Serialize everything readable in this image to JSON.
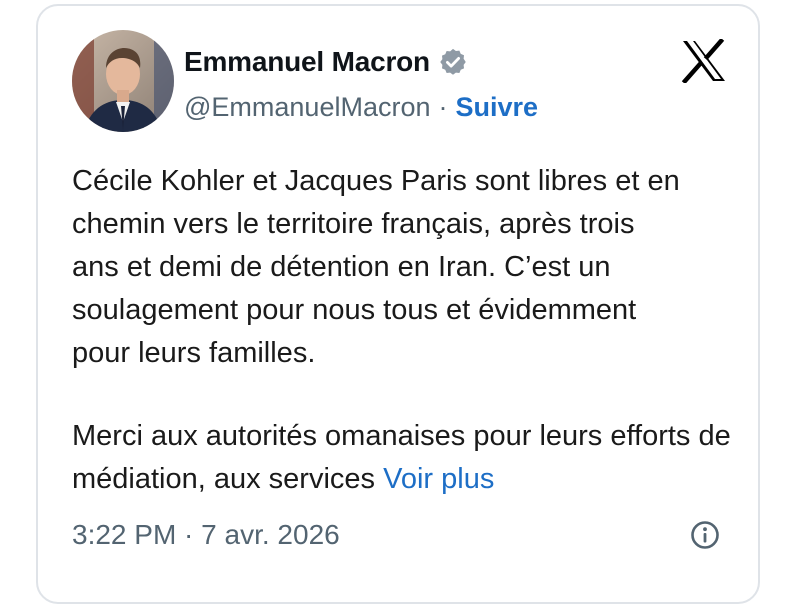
{
  "author": {
    "display_name": "Emmanuel Macron",
    "handle": "@EmmanuelMacron",
    "separator": "·",
    "follow_label": "Suivre"
  },
  "tweet": {
    "paragraph_1": "Cécile Kohler et Jacques Paris sont libres et en\nchemin vers le territoire français, après trois\nans et demi de détention en Iran. C’est un\nsoulagement pour nous tous et évidemment\npour leurs familles.",
    "paragraph_2": "Merci aux autorités omanaises pour leurs efforts de médiation, aux services ",
    "see_more_label": "Voir plus"
  },
  "footer": {
    "timestamp": "3:22 PM · 7 avr. 2026"
  },
  "icons": {
    "verified": "verified-badge-icon",
    "platform": "x-logo-icon",
    "info": "info-icon"
  },
  "colors": {
    "link": "#1d6ec6",
    "secondary_text": "#536471",
    "primary_text": "#0f1419",
    "card_border": "#dfe3e8"
  }
}
